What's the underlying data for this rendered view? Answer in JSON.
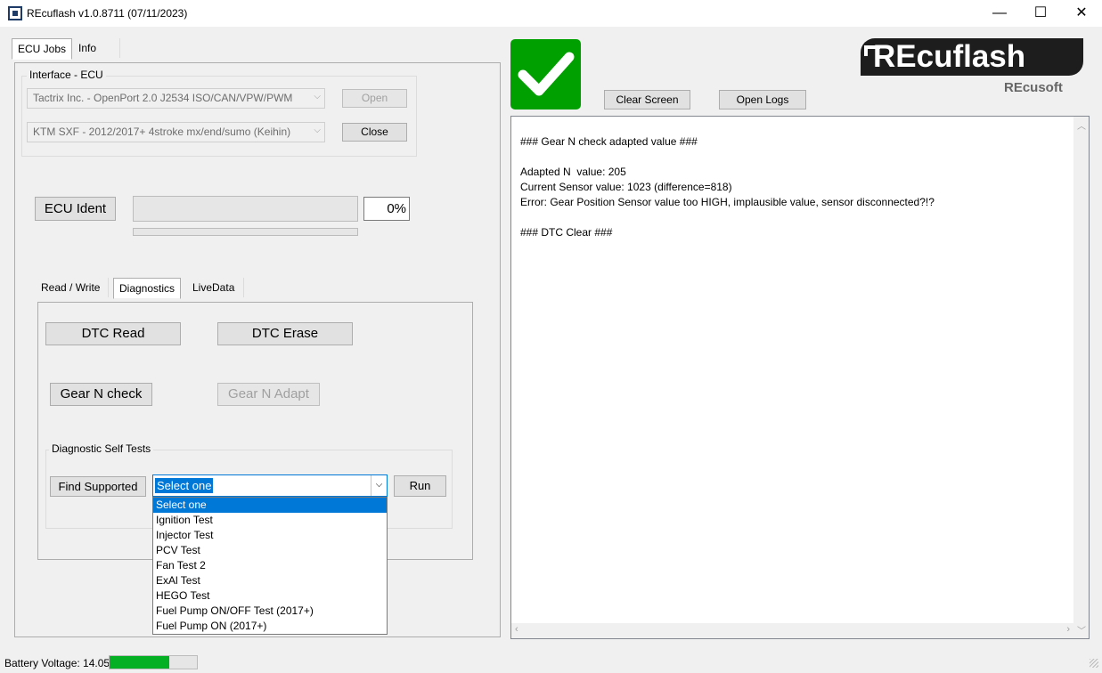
{
  "window": {
    "title": "REcuflash  v1.0.8711 (07/11/2023)",
    "minimize": "—",
    "maximize": "☐",
    "close": "✕"
  },
  "main_tabs": [
    "ECU Jobs",
    "Info"
  ],
  "interface": {
    "group_title": "Interface - ECU",
    "adapter": "Tactrix Inc. - OpenPort 2.0 J2534 ISO/CAN/VPW/PWM",
    "ecu": "KTM SXF - 2012/2017+ 4stroke mx/end/sumo (Keihin)",
    "open_label": "Open",
    "close_label": "Close"
  },
  "ident": {
    "button_label": "ECU Ident",
    "percent": "0%",
    "progress": 0
  },
  "sub_tabs": [
    "Read / Write",
    "Diagnostics",
    "LiveData"
  ],
  "diagnostics": {
    "dtc_read": "DTC Read",
    "dtc_erase": "DTC Erase",
    "gear_check": "Gear N check",
    "gear_adapt": "Gear N Adapt",
    "self_tests_title": "Diagnostic Self Tests",
    "find_supported": "Find Supported",
    "select_value": "Select one",
    "run_label": "Run",
    "options": [
      "Select one",
      "Ignition Test",
      "Injector Test",
      "PCV Test",
      "Fan Test 2",
      "ExAl Test",
      "HEGO Test",
      "Fuel Pump ON/OFF Test (2017+)",
      "Fuel Pump ON (2017+)"
    ]
  },
  "toolbar": {
    "clear_screen": "Clear Screen",
    "open_logs": "Open Logs"
  },
  "logo": {
    "brand": "REcuflash",
    "sub": "REcusoft",
    "status_color": "#00a000"
  },
  "log": {
    "text": "### Gear N check adapted value ###\n\nAdapted N  value: 205\nCurrent Sensor value: 1023 (difference=818)\nError: Gear Position Sensor value too HIGH, implausible value, sensor disconnected?!?\n\n### DTC Clear ###"
  },
  "status": {
    "battery_label": "Battery Voltage: 14.05",
    "battery_level": 0.68,
    "battery_color": "#06b025"
  }
}
